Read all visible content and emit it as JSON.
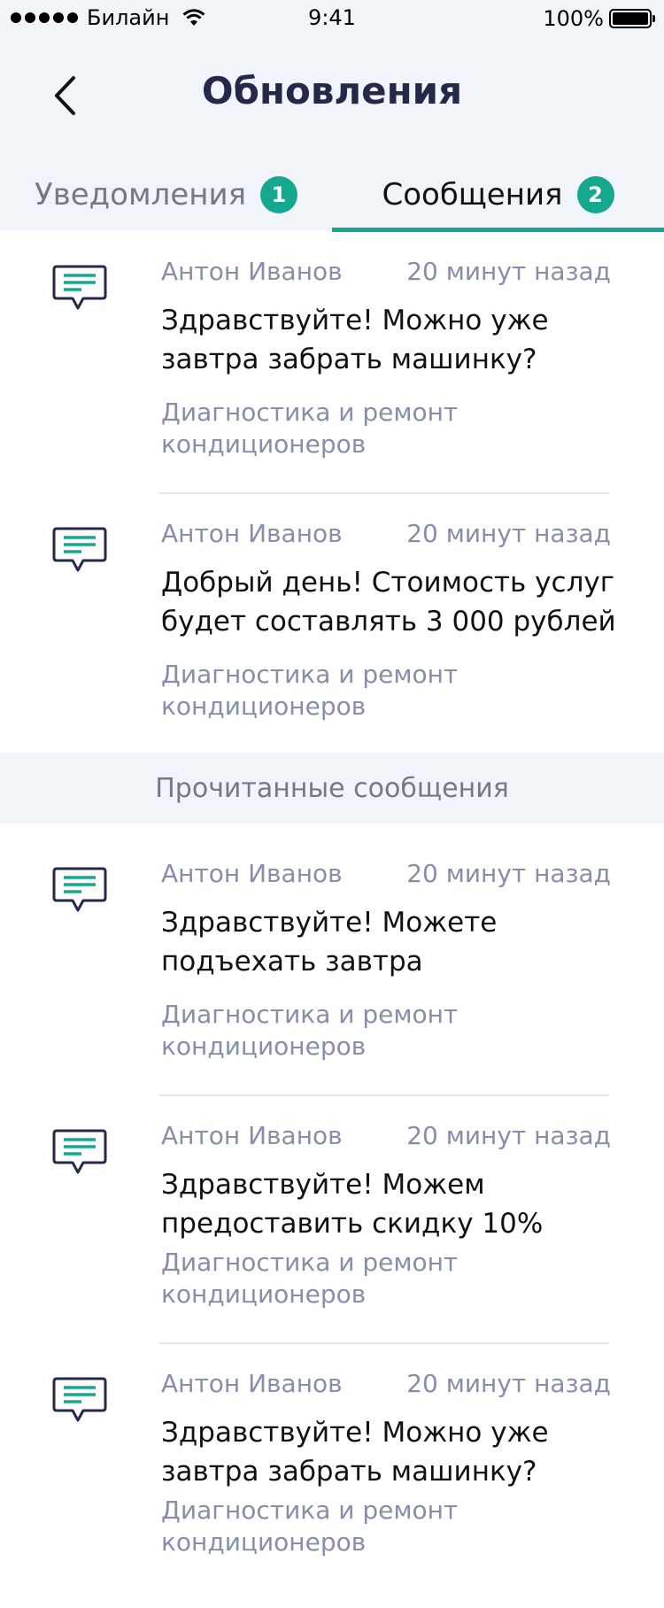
{
  "status_bar": {
    "carrier": "Билайн",
    "time": "9:41",
    "battery": "100%"
  },
  "header": {
    "title": "Обновления"
  },
  "tabs": [
    {
      "label": "Уведомления",
      "badge": "1"
    },
    {
      "label": "Сообщения",
      "badge": "2"
    }
  ],
  "unread_messages": [
    {
      "author": "Антон Иванов",
      "time": "20 минут назад",
      "text": "Здравствуйте! Можно уже завтра забрать машинку?",
      "service": "Диагностика и ремонт кондиционеров"
    },
    {
      "author": "Антон Иванов",
      "time": "20 минут назад",
      "text": "Добрый день! Стоимость услуг будет составлять 3 000 рублей",
      "service": "Диагностика и ремонт кондиционеров"
    }
  ],
  "read_section": {
    "label": "Прочитанные сообщения"
  },
  "read_messages": [
    {
      "author": "Антон Иванов",
      "time": "20 минут назад",
      "text": "Здравствуйте! Можете подъехать завтра",
      "service": "Диагностика и ремонт кондиционеров"
    },
    {
      "author": "Антон Иванов",
      "time": "20 минут назад",
      "text": "Здравствуйте! Можем предоставить скидку 10%",
      "service": "Диагностика и ремонт кондиционеров"
    },
    {
      "author": "Антон Иванов",
      "time": "20 минут назад",
      "text": "Здравствуйте! Можно уже завтра забрать машинку?",
      "service": "Диагностика и ремонт кондиционеров"
    }
  ],
  "colors": {
    "accent": "#16a88e",
    "title": "#24294a",
    "muted": "#868ea8",
    "header_bg": "#f1f4f8"
  },
  "icons": {
    "back": "chevron-left-icon",
    "message": "message-bubble-icon",
    "wifi": "wifi-icon",
    "battery": "battery-icon",
    "signal": "signal-dots-icon"
  }
}
